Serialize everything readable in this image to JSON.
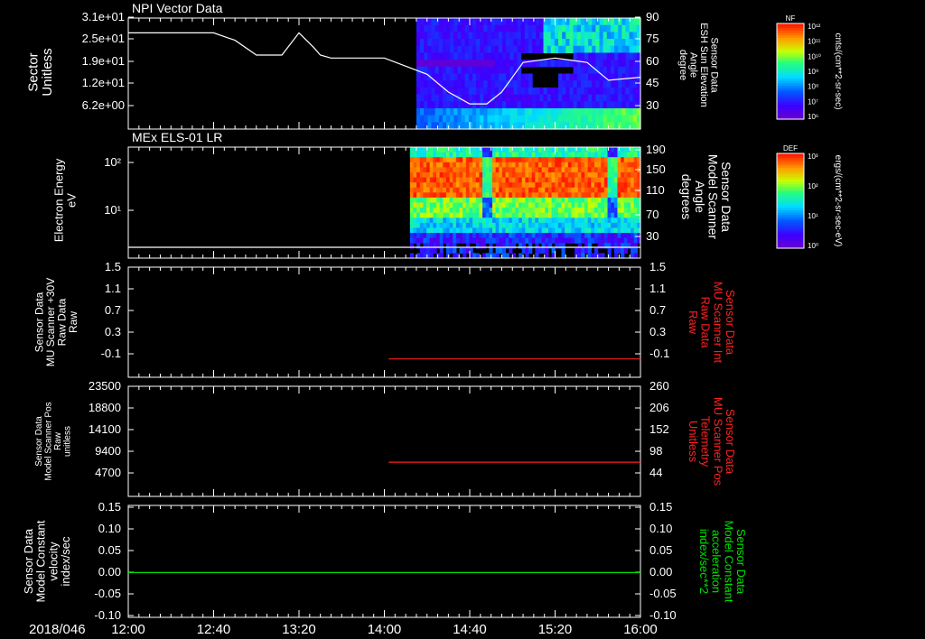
{
  "date_label": "2018/046",
  "x_ticks": [
    "12:00",
    "12:40",
    "13:20",
    "14:00",
    "14:40",
    "15:20",
    "16:00"
  ],
  "colorbars": [
    {
      "title": "NF",
      "unit": "cnts/(cm**2-sr-sec)",
      "labels": [
        "10¹²",
        "10¹¹",
        "10¹⁰",
        "10⁹",
        "10⁸",
        "10⁷",
        "10⁶"
      ]
    },
    {
      "title": "DEF",
      "unit": "ergs/(cm**2-sr-sec-eV)",
      "labels": [
        "10³",
        "10²",
        "10¹",
        "10⁰"
      ]
    }
  ],
  "colors": {
    "axis": "#ffffff",
    "red_line": "#ff2020",
    "green_line": "#00e000",
    "white_line": "#ffffff"
  },
  "chart_data": [
    {
      "type": "heatmap",
      "title": "NPI Vector Data",
      "ylabel": "Sector Unitless",
      "y_ticks": [
        "3.1e+01",
        "2.5e+01",
        "1.9e+01",
        "1.2e+01",
        "6.2e+00"
      ],
      "y2label": "Sensor Data ESH Sun Elevation Angle degree",
      "y2_ticks": [
        "90",
        "75",
        "60",
        "45",
        "30"
      ],
      "y2lim": [
        15,
        90
      ],
      "data_start": "14:15",
      "line": {
        "name": "ESH Sun Elevation Angle",
        "x": [
          "12:00",
          "12:40",
          "12:50",
          "13:00",
          "13:07",
          "13:12",
          "13:20",
          "13:27",
          "13:30",
          "13:35",
          "14:00",
          "14:20",
          "14:30",
          "14:40",
          "14:48",
          "14:55",
          "15:05",
          "15:20",
          "15:35",
          "15:45",
          "16:00"
        ],
        "y": [
          80,
          80,
          75,
          65,
          65,
          65,
          80,
          70,
          65,
          63,
          63,
          52,
          40,
          32,
          32,
          40,
          60,
          63,
          60,
          48,
          50
        ]
      }
    },
    {
      "type": "heatmap",
      "title": "MEx ELS-01 LR",
      "ylabel": "Electron Energy eV",
      "y_ticks": [
        "10²",
        "10¹"
      ],
      "y2label": "Sensor Data Model Scanner Angle degrees",
      "y2_ticks": [
        "190",
        "150",
        "110",
        "70",
        "30"
      ],
      "data_start": "14:12",
      "line": {
        "name": "Model Scanner Angle",
        "y": 10
      }
    },
    {
      "type": "line",
      "ylabel": "Sensor Data MU Scanner +30V Raw Data Raw",
      "y_ticks": [
        "1.5",
        "1.1",
        "0.7",
        "0.3",
        "-0.1"
      ],
      "y2label": "Sensor Data MU Scanner Int Raw Data Raw",
      "y2_ticks": [
        "1.5",
        "1.1",
        "0.7",
        "0.3",
        "-0.1"
      ],
      "ylim": [
        -0.3,
        1.5
      ],
      "series": [
        {
          "x": [
            "14:02",
            "16:00"
          ],
          "y": [
            0.0,
            0.0
          ]
        }
      ]
    },
    {
      "type": "line",
      "ylabel": "Sensor Data Model Scanner Pos Raw unitless",
      "y_ticks": [
        "23500",
        "18800",
        "14100",
        "9400",
        "4700"
      ],
      "y2label": "Sensor Data MU Scanner Pos Telemetry Unitless",
      "y2_ticks": [
        "260",
        "206",
        "152",
        "98",
        "44"
      ],
      "ylim": [
        0,
        23500
      ],
      "series": [
        {
          "x": [
            "14:02",
            "16:00"
          ],
          "y": [
            7300,
            7300
          ]
        }
      ]
    },
    {
      "type": "line",
      "ylabel": "Sensor Data Model Constant velocity index/sec",
      "y_ticks": [
        "0.15",
        "0.10",
        "0.05",
        "0.00",
        "-0.05",
        "-0.10"
      ],
      "y2label": "Sensor Data Model Constant acceleration index/sec**2",
      "y2_ticks": [
        "0.15",
        "0.10",
        "0.05",
        "0.00",
        "-0.05",
        "-0.10"
      ],
      "ylim": [
        -0.1,
        0.15
      ],
      "series": [
        {
          "x": [
            "12:00",
            "16:00"
          ],
          "y": [
            0.0,
            0.0
          ]
        }
      ]
    }
  ]
}
